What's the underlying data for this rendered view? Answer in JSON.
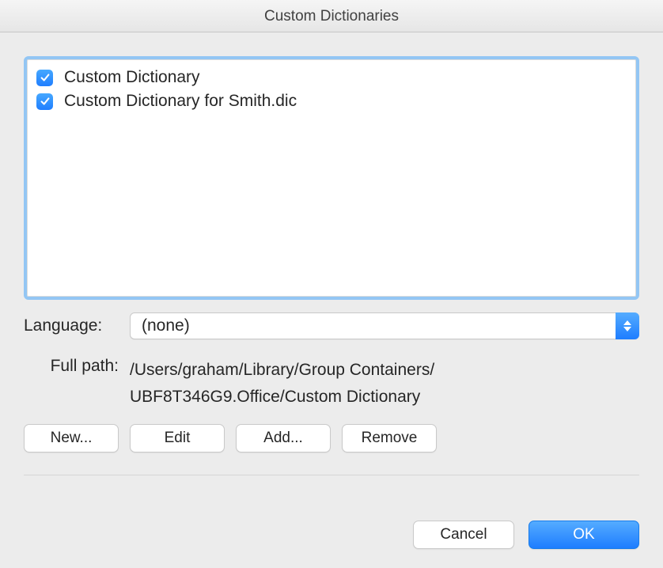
{
  "window": {
    "title": "Custom Dictionaries"
  },
  "list": {
    "items": [
      {
        "checked": true,
        "label": "Custom Dictionary"
      },
      {
        "checked": true,
        "label": "Custom Dictionary for Smith.dic"
      }
    ]
  },
  "language": {
    "label": "Language:",
    "value": "(none)"
  },
  "fullpath": {
    "label": "Full path:",
    "line1": "/Users/graham/Library/Group Containers/",
    "line2": "UBF8T346G9.Office/Custom Dictionary"
  },
  "buttons": {
    "new": "New...",
    "edit": "Edit",
    "add": "Add...",
    "remove": "Remove",
    "cancel": "Cancel",
    "ok": "OK"
  }
}
